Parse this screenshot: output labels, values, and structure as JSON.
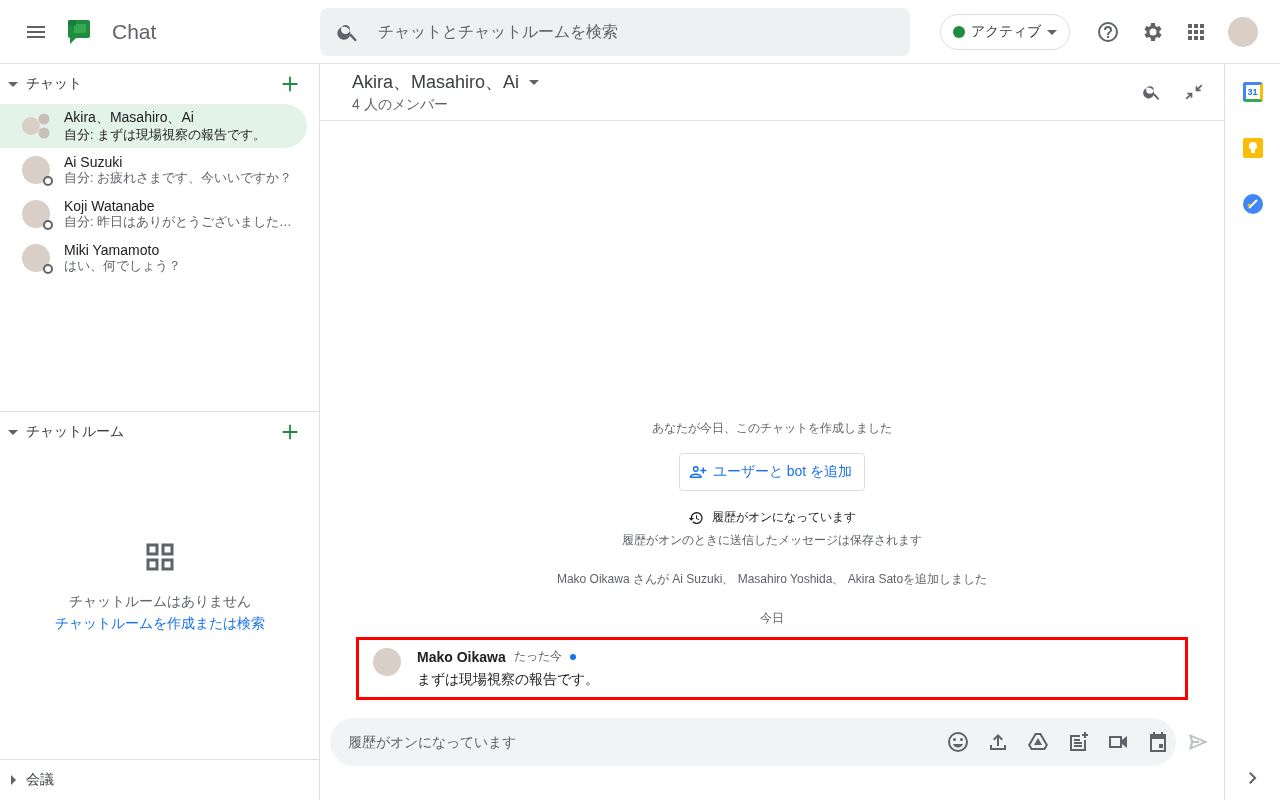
{
  "app": {
    "title": "Chat",
    "search_placeholder": "チャットとチャットルームを検索",
    "status": {
      "label": "アクティブ",
      "color": "#1e8e3e"
    }
  },
  "sidebar": {
    "sections": [
      {
        "title": "チャット",
        "expanded": true,
        "kind": "chats",
        "items": [
          {
            "name": "Akira、Masahiro、Ai",
            "preview": "自分: まずは現場視察の報告です。",
            "selected": true,
            "group": true,
            "presence_ring": false
          },
          {
            "name": "Ai Suzuki",
            "preview": "自分: お疲れさまです、今いいですか？",
            "selected": false,
            "group": false,
            "presence_ring": true
          },
          {
            "name": "Koji Watanabe",
            "preview": "自分: 昨日はありがとうございました…",
            "selected": false,
            "group": false,
            "presence_ring": true
          },
          {
            "name": "Miki Yamamoto",
            "preview": "はい、何でしょう？",
            "selected": false,
            "group": false,
            "presence_ring": true
          }
        ]
      },
      {
        "title": "チャットルーム",
        "expanded": true,
        "kind": "rooms",
        "empty_text": "チャットルームはありません",
        "empty_link": "チャットルームを作成または検索"
      },
      {
        "title": "会議",
        "expanded": false,
        "kind": "meetings"
      }
    ]
  },
  "conversation": {
    "title": "Akira、Masahiro、Ai",
    "subtitle": "4 人のメンバー",
    "created_text": "あなたが今日、このチャットを作成しました",
    "add_button": "ユーザーと bot を追加",
    "history_title": "履歴がオンになっています",
    "history_text": "履歴がオンのときに送信したメッセージは保存されます",
    "added_text": "Mako Oikawa さんが Ai Suzuki、 Masahiro Yoshida、 Akira Satoを追加しました",
    "date_divider": "今日",
    "messages": [
      {
        "author": "Mako Oikawa",
        "time": "たった今",
        "text": "まずは現場視察の報告です。",
        "unread_dot": true,
        "highlighted": true
      }
    ],
    "composer_placeholder": "履歴がオンになっています"
  },
  "rail": {
    "calendar_icon_text": "31"
  }
}
